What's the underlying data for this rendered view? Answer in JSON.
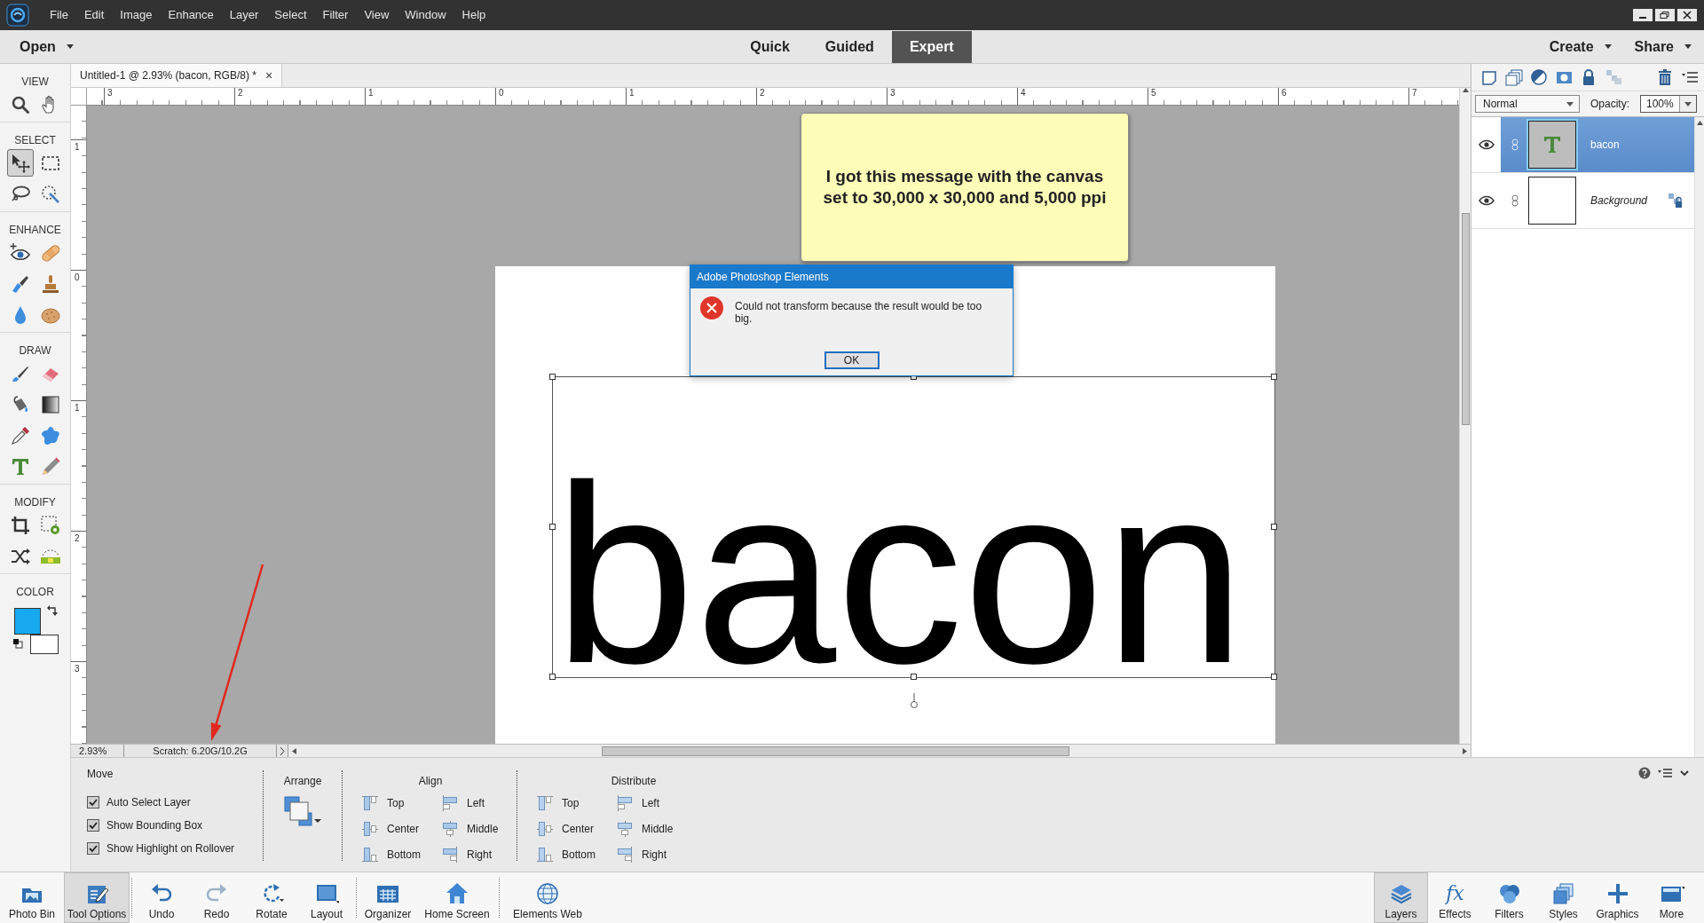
{
  "menu": [
    "File",
    "Edit",
    "Image",
    "Enhance",
    "Layer",
    "Select",
    "Filter",
    "View",
    "Window",
    "Help"
  ],
  "mode_bar": {
    "open": "Open",
    "modes": [
      {
        "label": "Quick",
        "selected": false
      },
      {
        "label": "Guided",
        "selected": false
      },
      {
        "label": "Expert",
        "selected": true
      }
    ],
    "actions": [
      "Create",
      "Share"
    ]
  },
  "toolbox": {
    "sections": [
      {
        "label": "VIEW",
        "tools": [
          {
            "selected": false
          },
          {
            "selected": false
          }
        ]
      },
      {
        "label": "SELECT",
        "tools": [
          {
            "selected": true
          },
          {
            "selected": false
          },
          {
            "selected": false
          },
          {
            "selected": false
          }
        ]
      },
      {
        "label": "ENHANCE",
        "tools": [
          {
            "selected": false
          },
          {
            "selected": false
          },
          {
            "selected": false
          },
          {
            "selected": false
          },
          {
            "selected": false
          },
          {
            "selected": false
          }
        ]
      },
      {
        "label": "DRAW",
        "tools": [
          {
            "selected": false
          },
          {
            "selected": false
          },
          {
            "selected": false
          },
          {
            "selected": false
          },
          {
            "selected": false
          },
          {
            "selected": false
          },
          {
            "selected": false
          },
          {
            "selected": false
          }
        ]
      },
      {
        "label": "MODIFY",
        "tools": [
          {
            "selected": false
          },
          {
            "selected": false
          },
          {
            "selected": false
          },
          {
            "selected": false
          }
        ]
      }
    ],
    "color": {
      "label": "COLOR",
      "swatches": [
        {
          "color": "#18a8f0"
        },
        {
          "color": "#ffffff"
        }
      ]
    }
  },
  "document": {
    "tab": {
      "title": "Untitled-1 @ 2.93% (bacon, RGB/8) *",
      "close": "×"
    },
    "ruler_horizontal": [
      "3",
      "2",
      "1",
      "0",
      "1",
      "2",
      "3",
      "4",
      "5",
      "6",
      "7"
    ],
    "ruler_vertical": [
      "1",
      "0",
      "1",
      "2",
      "3"
    ],
    "canvas_text": "bacon",
    "note": "I got this message with the canvas set to 30,000 x 30,000 and 5,000 ppi",
    "dialog": {
      "title": "Adobe Photoshop Elements",
      "message": "Could not transform because the result would be too big.",
      "button": "OK"
    },
    "status_bar": {
      "zoom": "2.93%",
      "scratch": "Scratch: 6.20G/10.2G"
    }
  },
  "layers_panel": {
    "blend_mode": "Normal",
    "opacity_label": "Opacity:",
    "opacity": "100%",
    "layers": [
      {
        "name": "bacon",
        "kind": "text",
        "selected": true
      },
      {
        "name": "Background",
        "kind": "background",
        "selected": false
      }
    ]
  },
  "tool_options": {
    "tool": "Move",
    "checkboxes": [
      {
        "label": "Auto Select Layer",
        "checked": true
      },
      {
        "label": "Show Bounding Box",
        "checked": true
      },
      {
        "label": "Show Highlight on Rollover",
        "checked": true
      }
    ],
    "arrange": "Arrange",
    "groups": [
      {
        "title": "Align",
        "options": [
          "Top",
          "Left",
          "Center",
          "Middle",
          "Bottom",
          "Right"
        ]
      },
      {
        "title": "Distribute",
        "options": [
          "Top",
          "Left",
          "Center",
          "Middle",
          "Bottom",
          "Right"
        ]
      }
    ]
  },
  "taskbar": {
    "left_groups": [
      [
        {
          "label": "Photo Bin",
          "selected": false
        },
        {
          "label": "Tool Options",
          "selected": true
        }
      ],
      [
        {
          "label": "Undo",
          "selected": false
        },
        {
          "label": "Redo",
          "selected": false
        },
        {
          "label": "Rotate",
          "selected": false
        },
        {
          "label": "Layout",
          "selected": false
        }
      ],
      [
        {
          "label": "Organizer",
          "selected": false
        },
        {
          "label": "Home Screen",
          "selected": false
        }
      ],
      [
        {
          "label": "Elements Web",
          "selected": false
        }
      ]
    ],
    "right": [
      {
        "label": "Layers",
        "selected": true
      },
      {
        "label": "Effects",
        "icon_text": "fx",
        "selected": false
      },
      {
        "label": "Filters",
        "selected": false
      },
      {
        "label": "Styles",
        "selected": false
      },
      {
        "label": "Graphics",
        "selected": false
      },
      {
        "label": "More",
        "selected": false
      }
    ]
  }
}
